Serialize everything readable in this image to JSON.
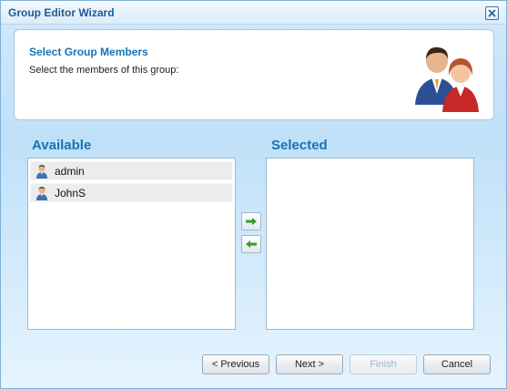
{
  "window": {
    "title": "Group Editor Wizard"
  },
  "header": {
    "title": "Select Group Members",
    "description": "Select the members of this group:"
  },
  "available": {
    "label": "Available",
    "items": [
      {
        "label": "admin",
        "icon": "user-icon"
      },
      {
        "label": "JohnS",
        "icon": "user-icon"
      }
    ]
  },
  "selected": {
    "label": "Selected",
    "items": []
  },
  "transfer": {
    "add_icon": "arrow-right-icon",
    "remove_icon": "arrow-left-icon",
    "arrow_color": "#3a9a2b"
  },
  "buttons": {
    "previous": "< Previous",
    "next": "Next >",
    "finish": "Finish",
    "cancel": "Cancel"
  },
  "colors": {
    "accent": "#1873b7",
    "title": "#1e5a91"
  }
}
